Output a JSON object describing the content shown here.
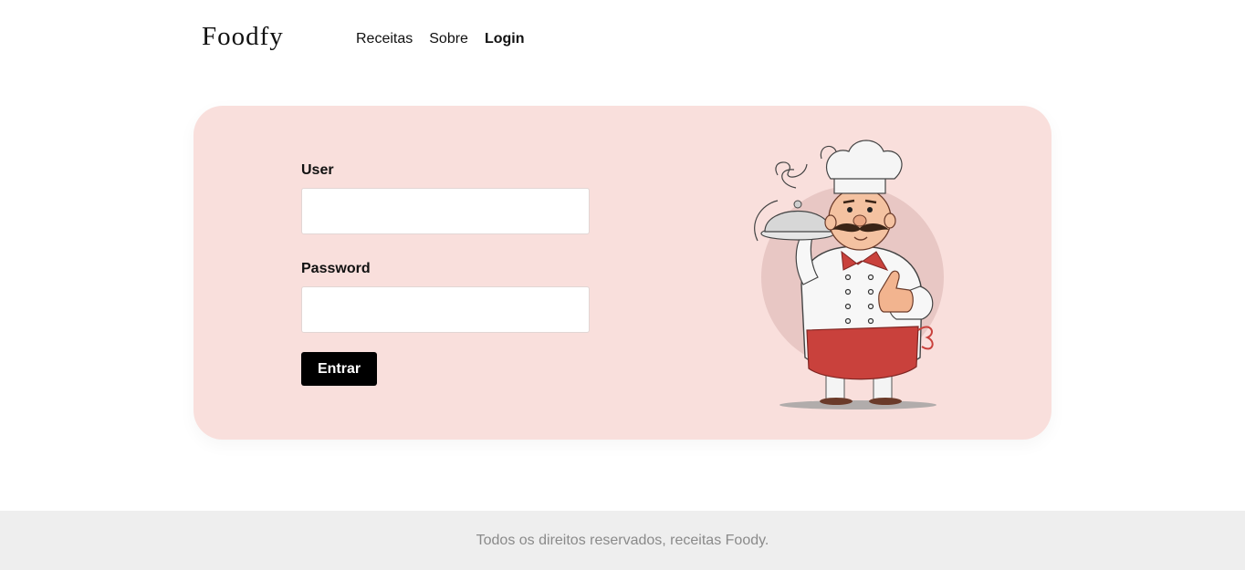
{
  "header": {
    "logo": "Foodfy",
    "nav": [
      {
        "label": "Receitas"
      },
      {
        "label": "Sobre"
      },
      {
        "label": "Login",
        "active": true
      }
    ]
  },
  "login_form": {
    "user_label": "User",
    "user_value": "",
    "password_label": "Password",
    "password_value": "",
    "submit_label": "Entrar"
  },
  "illustration": {
    "icon": "chef-illustration"
  },
  "footer": {
    "text": "Todos os direitos reservados, receitas Foody."
  },
  "colors": {
    "card_background": "#f9dfdc",
    "button_background": "#000000",
    "footer_background": "#eeeeee",
    "footer_text": "#8a8a8a"
  }
}
